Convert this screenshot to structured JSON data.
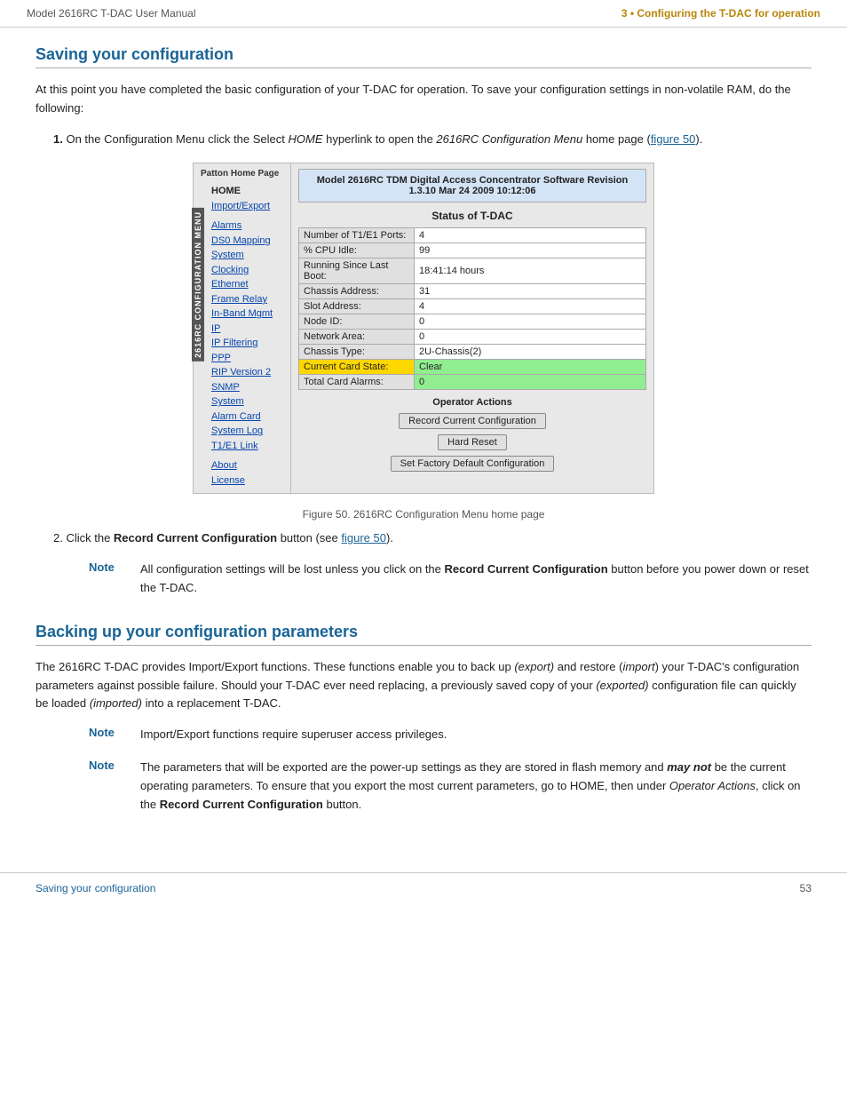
{
  "header": {
    "left": "Model 2616RC T-DAC User Manual",
    "right": "3 • Configuring the T-DAC for operation"
  },
  "section1": {
    "heading": "Saving your configuration",
    "intro": "At this point you have completed the basic configuration of your T-DAC for operation. To save your configuration settings in non-volatile RAM, do the following:",
    "step1": {
      "number": "1.",
      "text1": "On the Configuration Menu click the Select ",
      "text_italic": "HOME",
      "text2": " hyperlink to open the ",
      "text_italic2": "2616RC Configuration Menu",
      "text3": " home page (",
      "link": "figure 50",
      "text4": ")."
    }
  },
  "figure": {
    "patton_label": "Patton Home Page",
    "vertical_label": "2616RC CONFIGURATION MENU",
    "nav": {
      "home": "HOME",
      "import_export": "Import/Export",
      "alarms": "Alarms",
      "ds0_mapping": "DS0 Mapping",
      "system_clocking": "System Clocking",
      "ethernet": "Ethernet",
      "frame_relay": "Frame Relay",
      "in_band_mgmt": "In-Band Mgmt",
      "ip": "IP",
      "ip_filtering": "IP Filtering",
      "ppp": "PPP",
      "rip_version_2": "RIP Version 2",
      "snmp": "SNMP",
      "system": "System",
      "alarm_card": "Alarm Card",
      "system_log": "System Log",
      "t1e1_link": "T1/E1 Link",
      "about": "About",
      "license": "License"
    },
    "banner": "Model 2616RC TDM Digital Access Concentrator Software Revision 1.3.10 Mar 24 2009 10:12:06",
    "status_heading": "Status of T-DAC",
    "status_rows": [
      {
        "label": "Number of T1/E1 Ports:",
        "value": "4"
      },
      {
        "label": "% CPU Idle:",
        "value": "99"
      },
      {
        "label": "Running Since Last Boot:",
        "value": "18:41:14 hours"
      },
      {
        "label": "Chassis Address:",
        "value": "31"
      },
      {
        "label": "Slot Address:",
        "value": "4"
      },
      {
        "label": "Node ID:",
        "value": "0"
      },
      {
        "label": "Network Area:",
        "value": "0"
      },
      {
        "label": "Chassis Type:",
        "value": "2U-Chassis(2)"
      },
      {
        "label": "Current Card State:",
        "value": "Clear",
        "highlight": true
      },
      {
        "label": "Total Card Alarms:",
        "value": "0",
        "green": true
      }
    ],
    "operator_actions_title": "Operator Actions",
    "buttons": {
      "record": "Record Current Configuration",
      "hard_reset": "Hard Reset",
      "factory": "Set Factory Default Configuration"
    }
  },
  "figure_caption": "Figure 50. 2616RC Configuration Menu home page",
  "step2": {
    "text1": "2. Click the ",
    "bold": "Record Current Configuration",
    "text2": " button (see ",
    "link": "figure 50",
    "text3": ")."
  },
  "note1": {
    "label": "Note",
    "text": "All configuration settings will be lost unless you click on the Record Current Configuration button before you power down or reset the T-DAC."
  },
  "section2": {
    "heading": "Backing up your configuration parameters",
    "intro": "The 2616RC T-DAC provides Import/Export functions. These functions enable you to back up (export) and restore (import) your T-DAC's configuration parameters against possible failure. Should your T-DAC ever need replacing, a previously saved copy of your (exported) configuration file can quickly be loaded (imported) into a replacement T-DAC.",
    "note2": {
      "label": "Note",
      "text": "Import/Export functions require superuser access privileges."
    },
    "note3": {
      "label": "Note",
      "text": "The parameters that will be exported are the power-up settings as they are stored in flash memory and may not be the current operating parameters. To ensure that you export the most current parameters, go to HOME, then under Operator Actions, click on the Record Current Configuration button."
    }
  },
  "footer": {
    "left": "Saving your configuration",
    "right": "53"
  }
}
